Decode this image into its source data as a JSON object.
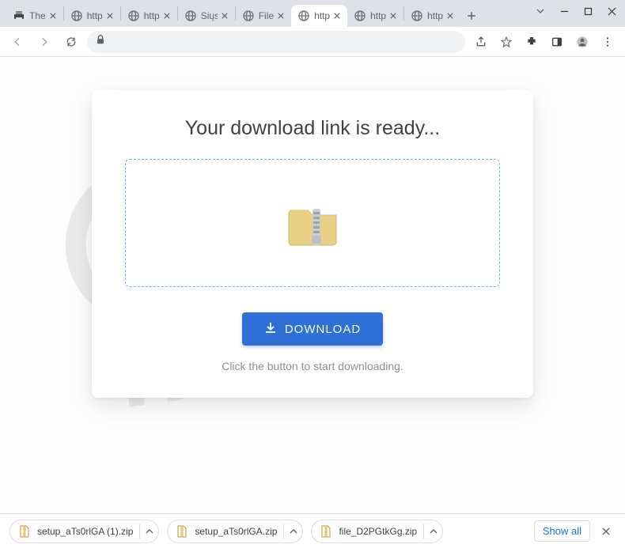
{
  "tabs": [
    {
      "label": "The",
      "favicon": "printer"
    },
    {
      "label": "http",
      "favicon": "globe"
    },
    {
      "label": "http",
      "favicon": "globe"
    },
    {
      "label": "Siųs",
      "favicon": "globe"
    },
    {
      "label": "File",
      "favicon": "globe"
    },
    {
      "label": "http",
      "favicon": "globe",
      "active": true
    },
    {
      "label": "http",
      "favicon": "globe"
    },
    {
      "label": "http",
      "favicon": "globe"
    }
  ],
  "card": {
    "title": "Your download link is ready...",
    "button_label": "DOWNLOAD",
    "hint": "Click the button to start downloading."
  },
  "shelf": {
    "items": [
      {
        "name": "setup_aTs0rlGA (1).zip"
      },
      {
        "name": "setup_aTs0rlGA.zip"
      },
      {
        "name": "file_D2PGtkGg.zip"
      }
    ],
    "show_all_label": "Show all"
  }
}
